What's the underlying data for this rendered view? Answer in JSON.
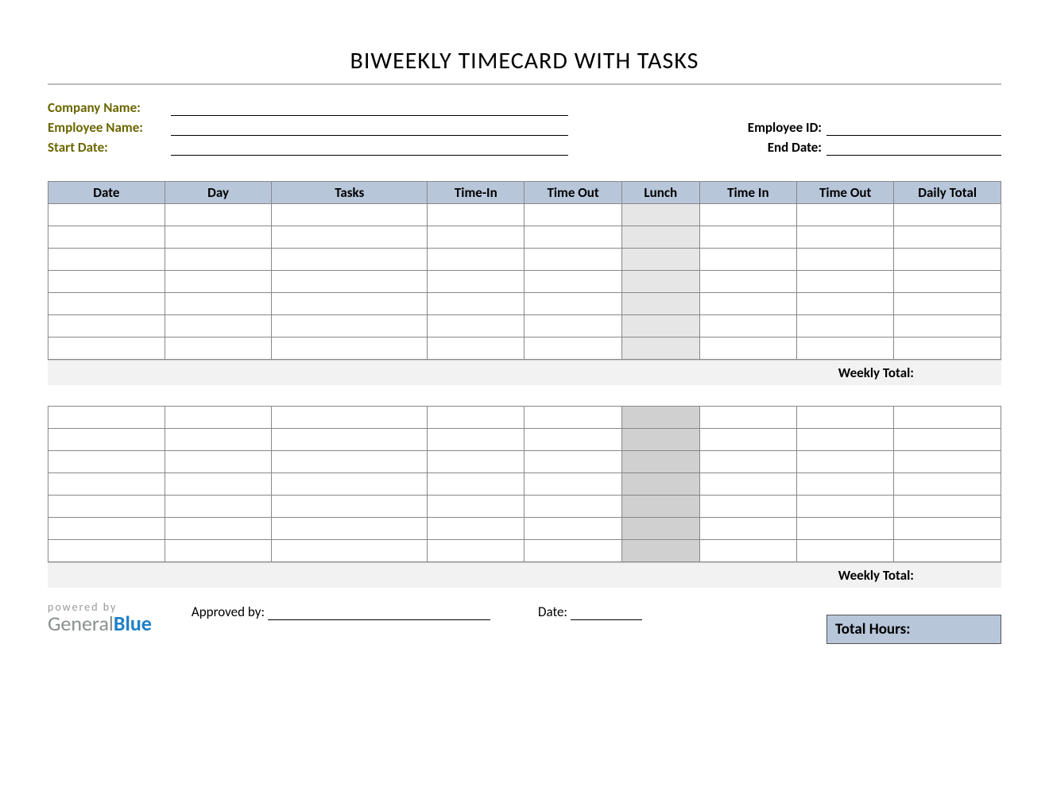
{
  "title": "BIWEEKLY TIMECARD WITH TASKS",
  "meta": {
    "company_label": "Company Name:",
    "employee_label": "Employee Name:",
    "start_label": "Start Date:",
    "employee_id_label": "Employee ID:",
    "end_label": "End Date:"
  },
  "columns": {
    "date": "Date",
    "day": "Day",
    "tasks": "Tasks",
    "time_in1": "Time-In",
    "time_out1": "Time Out",
    "lunch": "Lunch",
    "time_in2": "Time In",
    "time_out2": "Time Out",
    "daily_total": "Daily Total"
  },
  "weekly_total_label": "Weekly Total:",
  "footer": {
    "powered_by": "powered by",
    "logo_part1": "General",
    "logo_part2": "Blue",
    "approved_label": "Approved by:",
    "date_label": "Date:",
    "total_hours_label": "Total Hours:"
  }
}
